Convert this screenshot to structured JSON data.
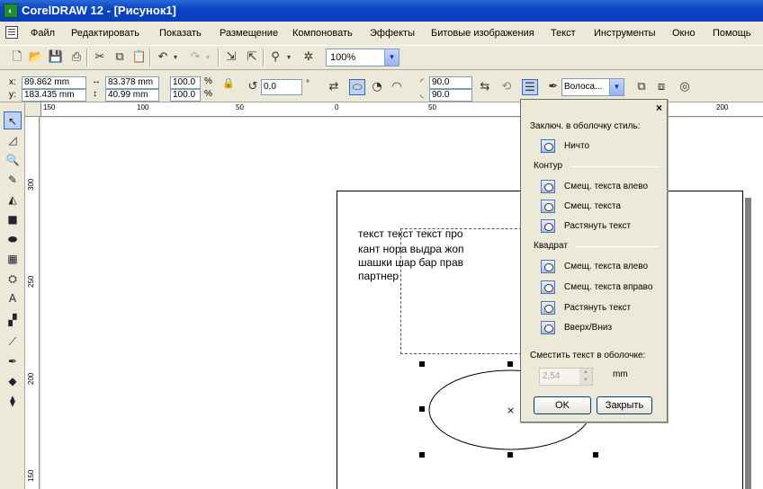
{
  "window": {
    "title": "CorelDRAW 12 - [Рисунок1]",
    "app_icon": "corel-balloon-icon"
  },
  "menu": [
    "Файл",
    "Редактировать",
    "Показать",
    "Размещение",
    "Компоновать",
    "Эффекты",
    "Битовые изображения",
    "Текст",
    "Инструменты",
    "Окно",
    "Помощь"
  ],
  "toolbar": {
    "zoom": "100%"
  },
  "propbar": {
    "x_label": "x:",
    "x_value": "89.862 mm",
    "y_label": "y:",
    "y_value": "183.435 mm",
    "w_value": "83.378 mm",
    "h_value": "40.99 mm",
    "scale_x": "100.0",
    "scale_y": "100.0",
    "percent": "%",
    "rotation": "0,0",
    "degree": "°",
    "angle1": "90.0",
    "angle2": "90.0",
    "outline": "Волоса..."
  },
  "ruler_h": [
    "150",
    "100",
    "50",
    "0",
    "50",
    "200"
  ],
  "ruler_v": [
    "300",
    "250",
    "200",
    "150"
  ],
  "canvas": {
    "text_lines": [
      "текст текст текст про",
      "кант нора выдра жоп",
      "шашки шар бар прав",
      "партнер"
    ]
  },
  "dialog": {
    "close": "×",
    "wrap_style_label": "Заключ. в оболочку стиль:",
    "none": "Ничто",
    "contour_section": "Контур",
    "contour_options": [
      "Смещ. текста влево",
      "Смещ. текста",
      "Растянуть текст"
    ],
    "square_section": "Квадрат",
    "square_options": [
      "Смещ. текста влево",
      "Смещ. текста вправо",
      "Растянуть текст",
      "Вверх/Вниз"
    ],
    "offset_label": "Сместить текст в оболочке:",
    "offset_value": "2,54",
    "unit": "mm",
    "ok": "OK",
    "close_btn": "Закрыть"
  }
}
